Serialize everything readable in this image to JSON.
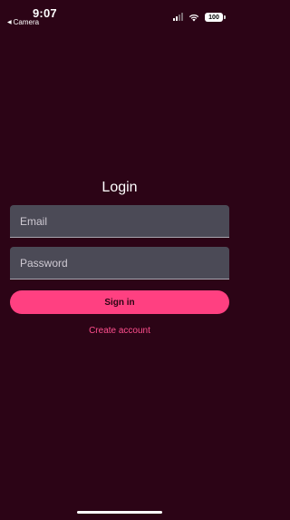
{
  "status_bar": {
    "time": "9:07",
    "back_app": "Camera",
    "battery": "100"
  },
  "login": {
    "title": "Login",
    "email_placeholder": "Email",
    "password_placeholder": "Password",
    "signin_label": "Sign in",
    "create_account_label": "Create account"
  },
  "colors": {
    "background": "#2c0416",
    "field": "#4b4a56",
    "accent": "#ff4081"
  }
}
